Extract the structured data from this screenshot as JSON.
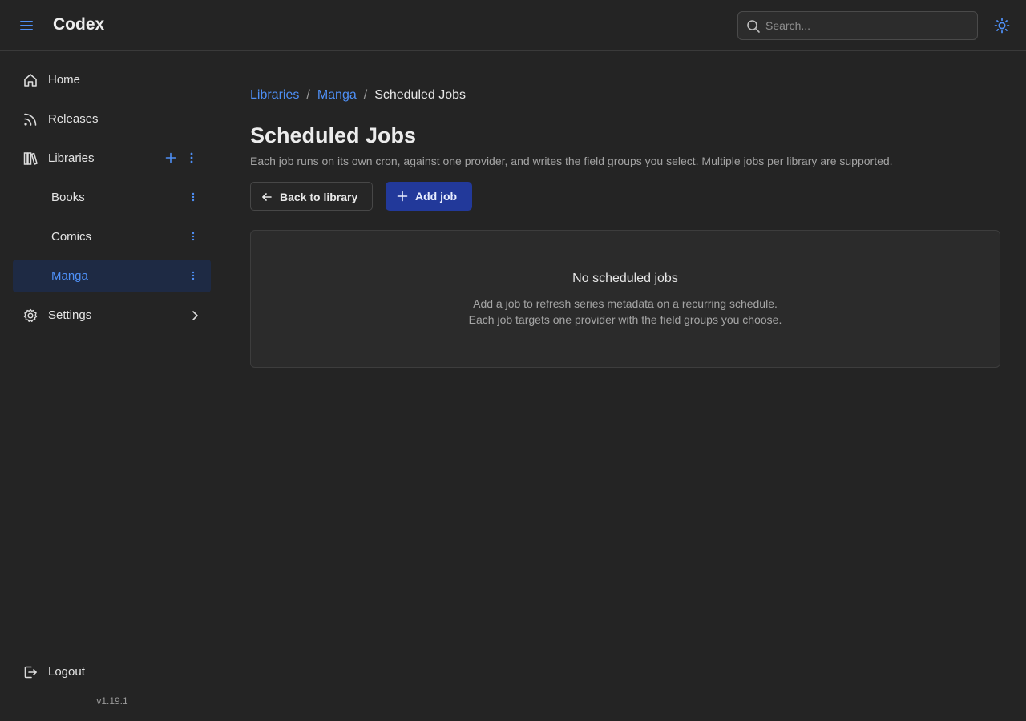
{
  "app": {
    "title": "Codex",
    "version": "v1.19.1"
  },
  "search": {
    "placeholder": "Search...",
    "value": ""
  },
  "sidebar": {
    "items": [
      {
        "label": "Home",
        "icon": "home-icon"
      },
      {
        "label": "Releases",
        "icon": "rss-icon"
      },
      {
        "label": "Libraries",
        "icon": "library-icon"
      }
    ],
    "libraries": [
      {
        "label": "Books",
        "active": false
      },
      {
        "label": "Comics",
        "active": false
      },
      {
        "label": "Manga",
        "active": true
      }
    ],
    "settings_label": "Settings",
    "logout_label": "Logout"
  },
  "breadcrumb": {
    "libraries": "Libraries",
    "library": "Manga",
    "current": "Scheduled Jobs"
  },
  "page": {
    "title": "Scheduled Jobs",
    "description": "Each job runs on its own cron, against one provider, and writes the field groups you select. Multiple jobs per library are supported."
  },
  "actions": {
    "back_label": "Back to library",
    "add_label": "Add job"
  },
  "empty": {
    "title": "No scheduled jobs",
    "line1": "Add a job to refresh series metadata on a recurring schedule.",
    "line2": "Each job targets one provider with the field groups you choose."
  },
  "colors": {
    "accent": "#4e8ff5",
    "primary_button": "#22399a",
    "active_nav": "#1e2a44",
    "background": "#242424"
  }
}
